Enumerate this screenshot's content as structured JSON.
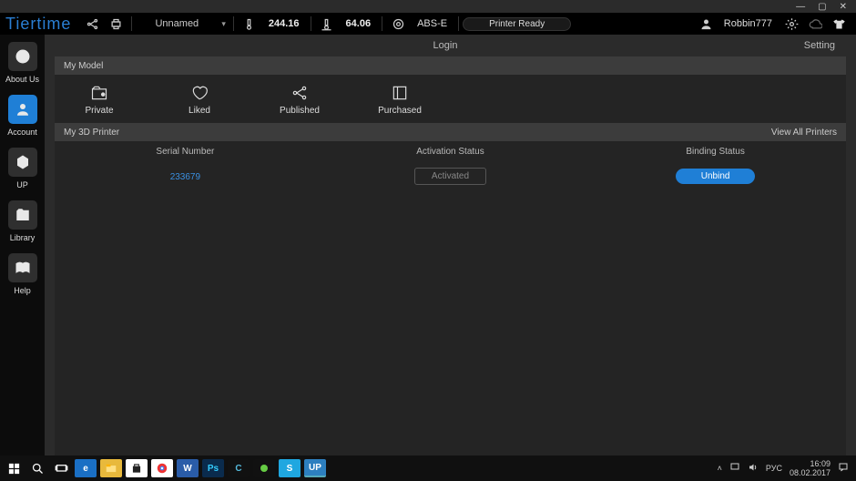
{
  "window": {
    "min": "—",
    "max": "▢",
    "close": "✕"
  },
  "toolbar": {
    "brand": "Tiertime",
    "printer_name": "Unnamed",
    "temp1": "244.16",
    "temp2": "64.06",
    "material": "ABS-E",
    "status": "Printer Ready",
    "user": "Robbin777"
  },
  "subhead": {
    "login": "Login",
    "setting": "Setting"
  },
  "nav": {
    "about": "About Us",
    "account": "Account",
    "up": "UP",
    "library": "Library",
    "help": "Help"
  },
  "mymodel": {
    "title": "My Model",
    "private": "Private",
    "liked": "Liked",
    "published": "Published",
    "purchased": "Purchased"
  },
  "printer_panel": {
    "title": "My 3D Printer",
    "viewall": "View All Printers",
    "col_sn": "Serial Number",
    "col_act": "Activation Status",
    "col_bind": "Binding Status",
    "serial": "233679",
    "activated": "Activated",
    "unbind": "Unbind"
  },
  "tray": {
    "lang": "РУС",
    "time": "16:09",
    "date": "08.02.2017"
  }
}
